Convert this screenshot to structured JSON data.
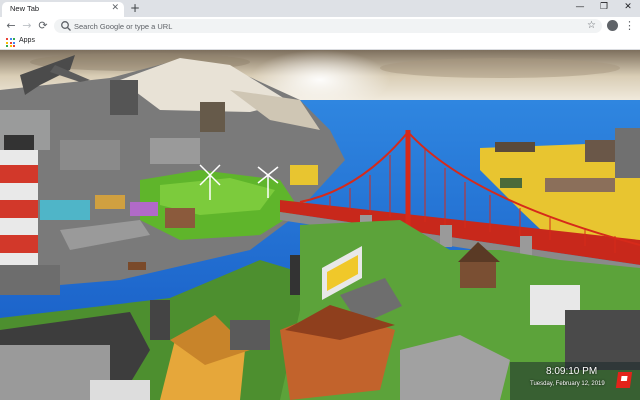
{
  "tab": {
    "title": "New Tab",
    "close_icon": "✕"
  },
  "new_tab_icon": "+",
  "window_controls": {
    "minimize": "—",
    "restore": "❐",
    "close": "✕"
  },
  "nav": {
    "back": "←",
    "forward": "→",
    "reload": "⟳"
  },
  "omnibox": {
    "placeholder": "Search Google or type a URL",
    "star_icon": "☆"
  },
  "menu_icon": "⋮",
  "bookmarks": {
    "apps_label": "Apps"
  },
  "wallpaper": {
    "time": "8:09:10 PM",
    "date": "Tuesday, February 12, 2019"
  },
  "colors": {
    "tabstrip": "#dee1e6",
    "sea": "#1f73d6",
    "bridge": "#d62a1a",
    "grass": "#5fb52b"
  }
}
